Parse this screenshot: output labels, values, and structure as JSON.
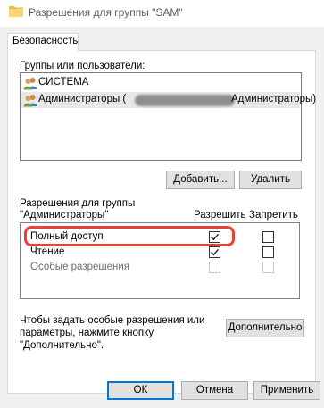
{
  "window": {
    "title": "Разрешения для группы \"SAM\""
  },
  "tabs": [
    {
      "label": "Безопасность"
    }
  ],
  "groups": {
    "label": "Группы или пользователи:",
    "items": [
      {
        "name": "СИСТЕМА",
        "icon": "users-icon"
      },
      {
        "name": "Администраторы (",
        "suffix": "Администраторы)",
        "icon": "users-icon",
        "selected": true
      }
    ],
    "add_button": "Добавить...",
    "remove_button": "Удалить"
  },
  "permissions": {
    "label_line1": "Разрешения для группы",
    "label_line2": "\"Администраторы\"",
    "col_allow": "Разрешить",
    "col_deny": "Запретить",
    "rows": [
      {
        "name": "Полный доступ",
        "allow": true,
        "deny": false,
        "disabled": false
      },
      {
        "name": "Чтение",
        "allow": true,
        "deny": false,
        "disabled": false
      },
      {
        "name": "Особые разрешения",
        "allow": false,
        "deny": false,
        "disabled": true
      }
    ],
    "highlight_color": "#e8403a"
  },
  "advanced": {
    "text_line1": "Чтобы задать особые разрешения или",
    "text_line2": "параметры, нажмите кнопку",
    "text_line3": "\"Дополнительно\".",
    "button": "Дополнительно"
  },
  "footer": {
    "ok": "ОК",
    "cancel": "Отмена",
    "apply": "Применить"
  },
  "colors": {
    "accent": "#0078d7",
    "dialog_bg": "#f0f0f0",
    "button_bg": "#e1e1e1"
  }
}
